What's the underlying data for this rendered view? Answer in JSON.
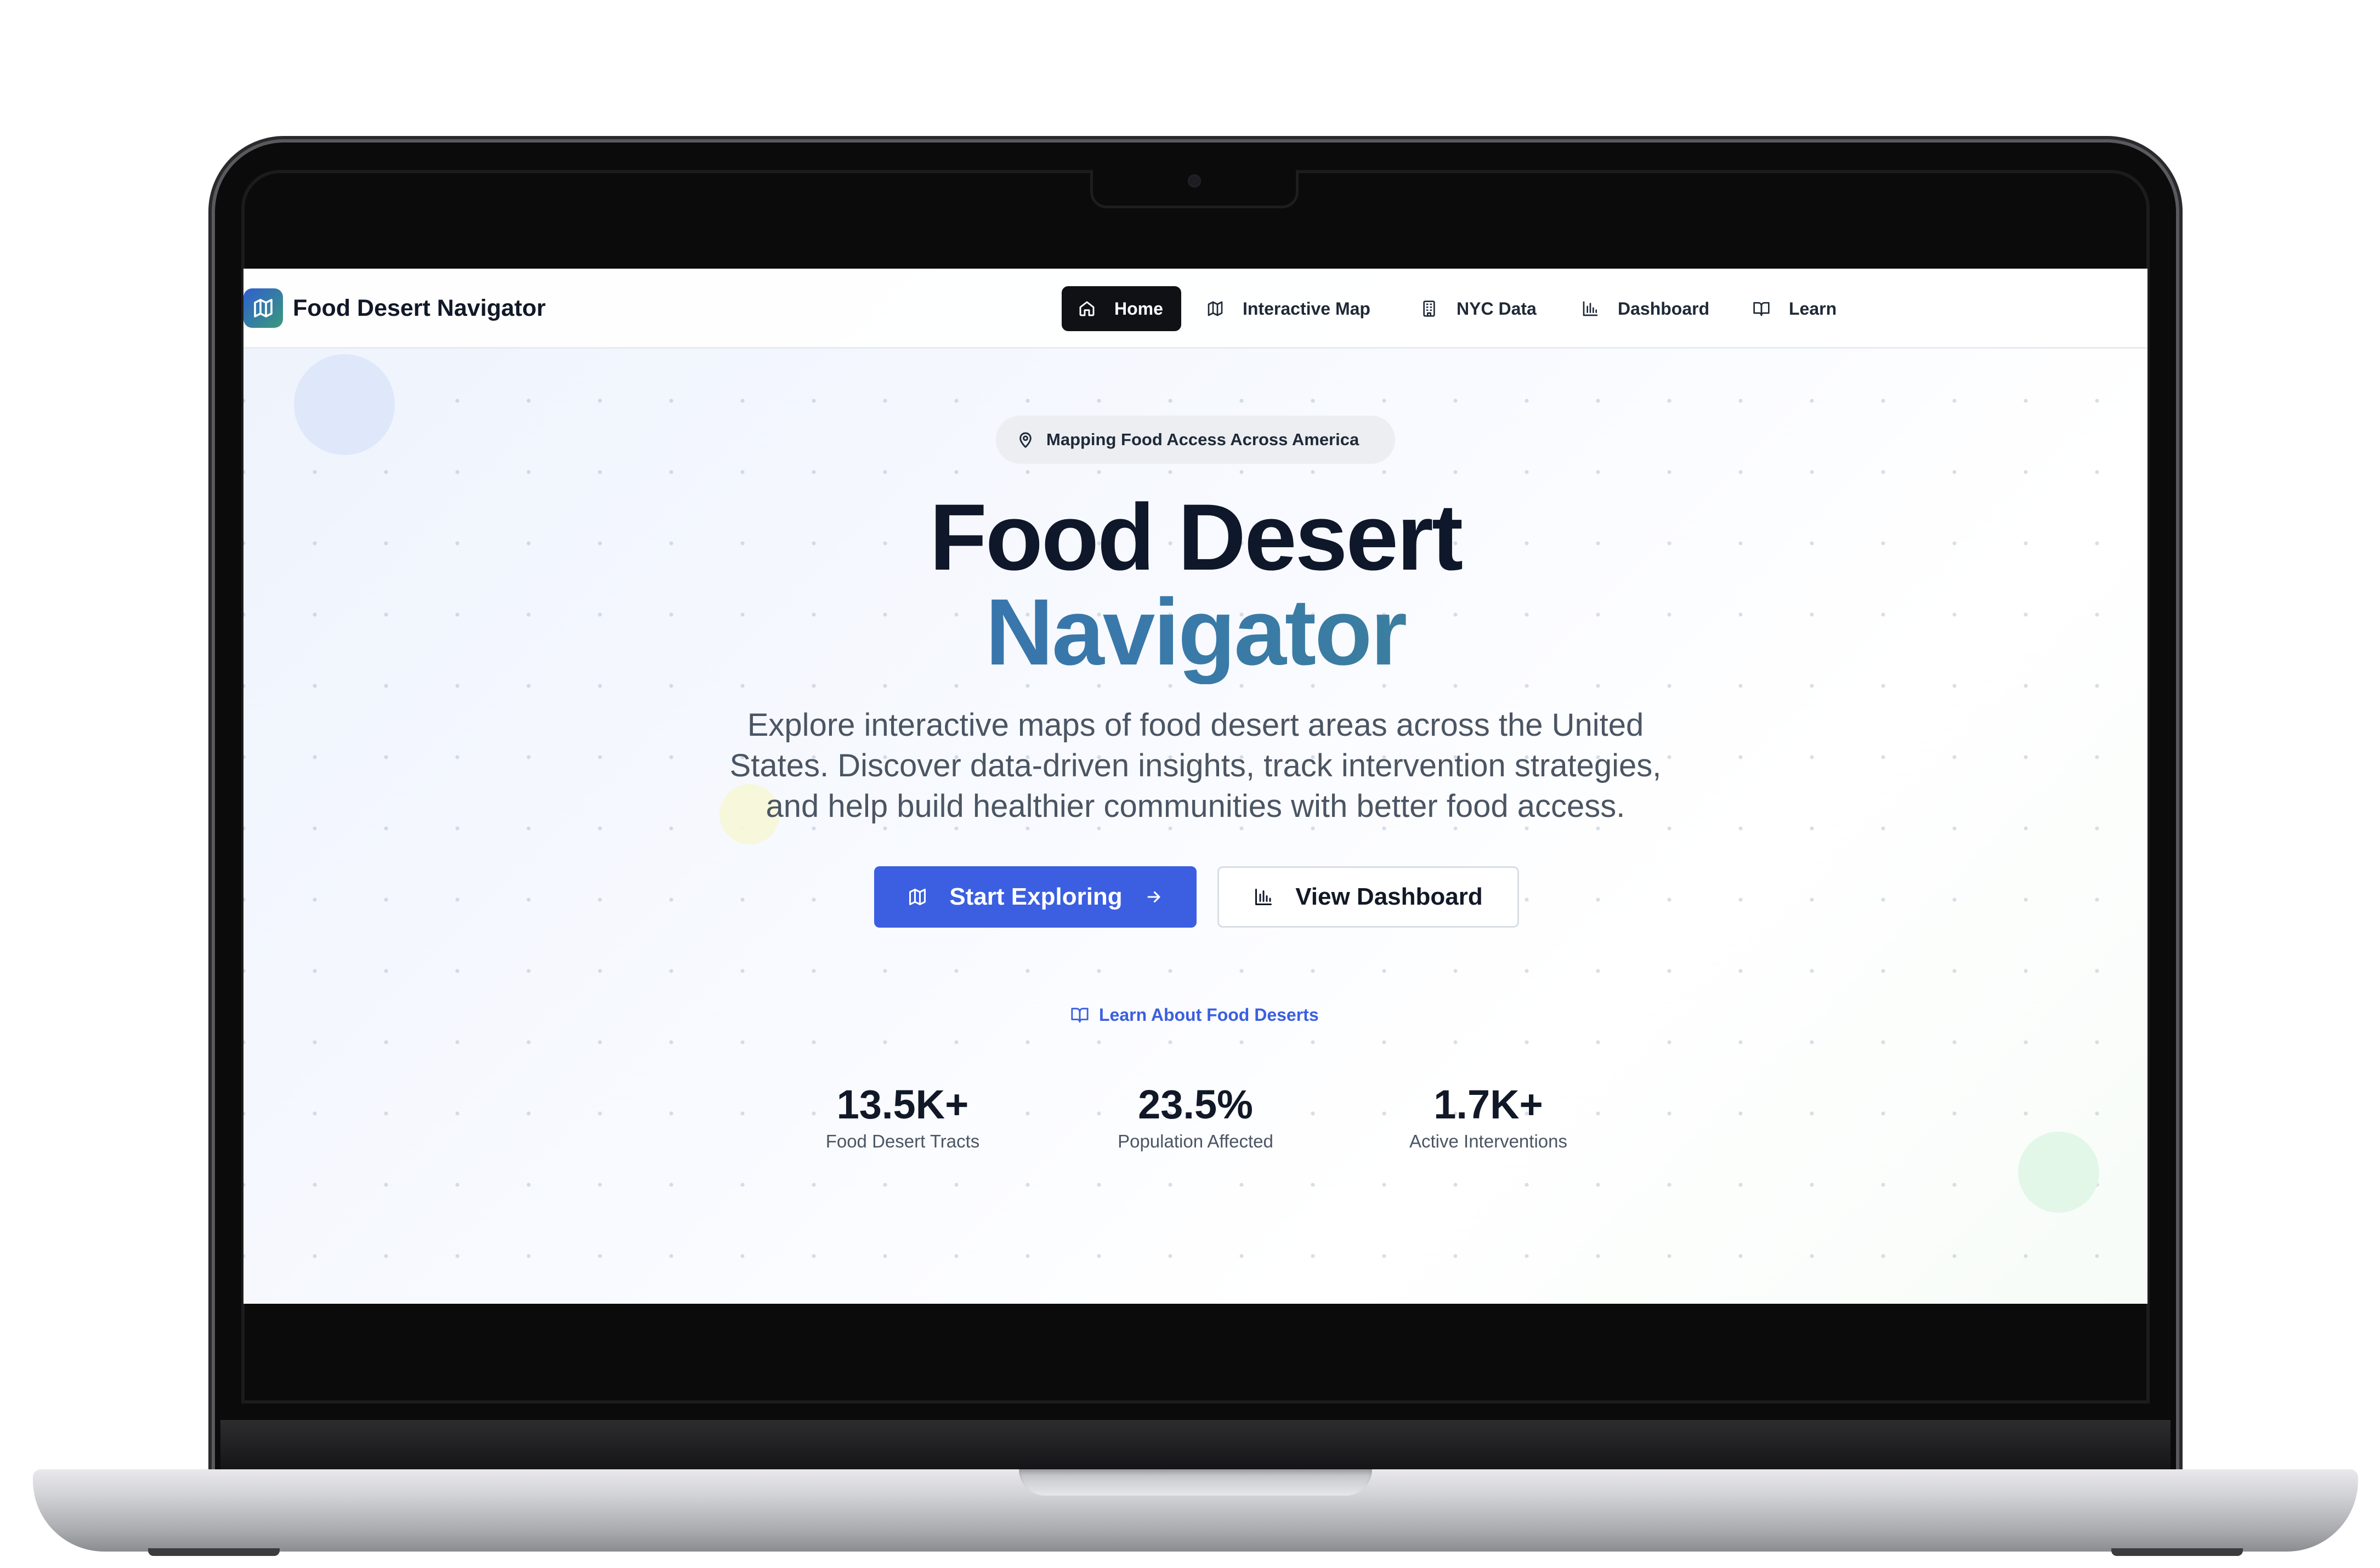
{
  "app": {
    "name": "Food Desert Navigator"
  },
  "nav": {
    "items": [
      {
        "label": "Home",
        "icon": "home-icon",
        "active": true
      },
      {
        "label": "Interactive Map",
        "icon": "map-icon",
        "active": false
      },
      {
        "label": "NYC Data",
        "icon": "building-icon",
        "active": false
      },
      {
        "label": "Dashboard",
        "icon": "bar-chart-icon",
        "active": false
      },
      {
        "label": "Learn",
        "icon": "book-open-icon",
        "active": false
      }
    ]
  },
  "hero": {
    "badge": "Mapping Food Access Across America",
    "title_line1": "Food Desert",
    "title_line2": "Navigator",
    "description": "Explore interactive maps of food desert areas across the United States. Discover data-driven insights, track intervention strategies, and help build healthier communities with better food access.",
    "primary_button": "Start Exploring",
    "secondary_button": "View Dashboard",
    "learn_link": "Learn About Food Deserts"
  },
  "stats": [
    {
      "value": "13.5K+",
      "label": "Food Desert Tracts"
    },
    {
      "value": "23.5%",
      "label": "Population Affected"
    },
    {
      "value": "1.7K+",
      "label": "Active Interventions"
    }
  ],
  "colors": {
    "accent": "#3b5fe0",
    "title_gradient_start": "#2f64b8",
    "title_gradient_end": "#3d8b80",
    "nav_active_bg": "#0f1115",
    "text_dark": "#111827"
  }
}
